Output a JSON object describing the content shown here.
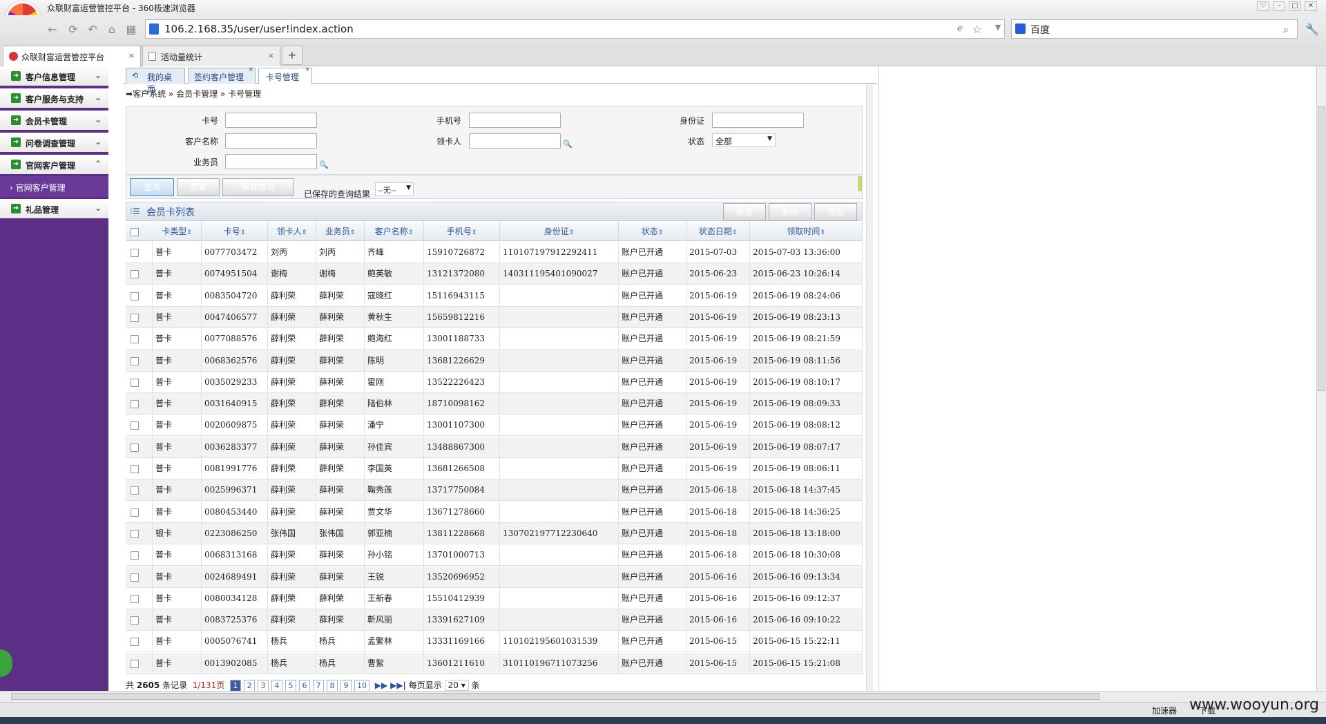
{
  "window": {
    "title": "众联财富运营管控平台 - 360极速浏览器"
  },
  "address_bar": {
    "url": "106.2.168.35/user/user!index.action",
    "search_engine": "百度"
  },
  "browser_tabs": [
    {
      "label": "众联财富运营管控平台"
    },
    {
      "label": "活动量统计"
    }
  ],
  "sidebar": {
    "items": [
      {
        "label": "客户信息管理"
      },
      {
        "label": "客户服务与支持"
      },
      {
        "label": "会员卡管理"
      },
      {
        "label": "问卷调查管理"
      },
      {
        "label": "官网客户管理"
      },
      {
        "label": "礼品管理"
      }
    ],
    "sub_item": "官网客户管理"
  },
  "inner_tabs": [
    {
      "label": "我的桌面"
    },
    {
      "label": "签约客户管理"
    },
    {
      "label": "卡号管理"
    }
  ],
  "breadcrumb": {
    "l1": "客户系统",
    "l2": "会员卡管理",
    "l3": "卡号管理"
  },
  "search": {
    "card_no": "卡号",
    "phone": "手机号",
    "id_card": "身份证",
    "customer_name": "客户名称",
    "receiver": "领卡人",
    "status": "状态",
    "status_value": "全部",
    "salesman": "业务员"
  },
  "buttons": {
    "query": "查询",
    "reset": "重置",
    "save_query": "保存查询",
    "saved_label": "已保存的查询结果",
    "saved_value": "--无--"
  },
  "grid": {
    "title": "会员卡列表",
    "actions": [
      "新增",
      "删除",
      "导出"
    ],
    "columns": [
      "卡类型",
      "卡号",
      "领卡人",
      "业务员",
      "客户名称",
      "手机号",
      "身份证",
      "状态",
      "状态日期",
      "领取时间"
    ],
    "rows": [
      [
        "普卡",
        "0077703472",
        "刘丙",
        "刘丙",
        "齐峰",
        "15910726872",
        "110107197912292411",
        "账户已开通",
        "2015-07-03",
        "2015-07-03 13:36:00"
      ],
      [
        "普卡",
        "0074951504",
        "谢梅",
        "谢梅",
        "鲍英敏",
        "13121372080",
        "140311195401090027",
        "账户已开通",
        "2015-06-23",
        "2015-06-23 10:26:14"
      ],
      [
        "普卡",
        "0083504720",
        "薛利荣",
        "薛利荣",
        "寇晓红",
        "15116943115",
        "",
        "账户已开通",
        "2015-06-19",
        "2015-06-19 08:24:06"
      ],
      [
        "普卡",
        "0047406577",
        "薛利荣",
        "薛利荣",
        "黄秋生",
        "15659812216",
        "",
        "账户已开通",
        "2015-06-19",
        "2015-06-19 08:23:13"
      ],
      [
        "普卡",
        "0077088576",
        "薛利荣",
        "薛利荣",
        "鲍海红",
        "13001188733",
        "",
        "账户已开通",
        "2015-06-19",
        "2015-06-19 08:21:59"
      ],
      [
        "普卡",
        "0068362576",
        "薛利荣",
        "薛利荣",
        "陈明",
        "13681226629",
        "",
        "账户已开通",
        "2015-06-19",
        "2015-06-19 08:11:56"
      ],
      [
        "普卡",
        "0035029233",
        "薛利荣",
        "薛利荣",
        "霍刚",
        "13522226423",
        "",
        "账户已开通",
        "2015-06-19",
        "2015-06-19 08:10:17"
      ],
      [
        "普卡",
        "0031640915",
        "薛利荣",
        "薛利荣",
        "陆伯林",
        "18710098162",
        "",
        "账户已开通",
        "2015-06-19",
        "2015-06-19 08:09:33"
      ],
      [
        "普卡",
        "0020609875",
        "薛利荣",
        "薛利荣",
        "潘宁",
        "13001107300",
        "",
        "账户已开通",
        "2015-06-19",
        "2015-06-19 08:08:12"
      ],
      [
        "普卡",
        "0036283377",
        "薛利荣",
        "薛利荣",
        "孙佳宾",
        "13488867300",
        "",
        "账户已开通",
        "2015-06-19",
        "2015-06-19 08:07:17"
      ],
      [
        "普卡",
        "0081991776",
        "薛利荣",
        "薛利荣",
        "李国英",
        "13681266508",
        "",
        "账户已开通",
        "2015-06-19",
        "2015-06-19 08:06:11"
      ],
      [
        "普卡",
        "0025996371",
        "薛利荣",
        "薛利荣",
        "鞠秀莲",
        "13717750084",
        "",
        "账户已开通",
        "2015-06-18",
        "2015-06-18 14:37:45"
      ],
      [
        "普卡",
        "0080453440",
        "薛利荣",
        "薛利荣",
        "贾文华",
        "13671278660",
        "",
        "账户已开通",
        "2015-06-18",
        "2015-06-18 14:36:25"
      ],
      [
        "银卡",
        "0223086250",
        "张伟国",
        "张伟国",
        "郭亚楠",
        "13811228668",
        "130702197712230640",
        "账户已开通",
        "2015-06-18",
        "2015-06-18 13:18:00"
      ],
      [
        "普卡",
        "0068313168",
        "薛利荣",
        "薛利荣",
        "孙小铭",
        "13701000713",
        "",
        "账户已开通",
        "2015-06-18",
        "2015-06-18 10:30:08"
      ],
      [
        "普卡",
        "0024689491",
        "薛利荣",
        "薛利荣",
        "王锐",
        "13520696952",
        "",
        "账户已开通",
        "2015-06-16",
        "2015-06-16 09:13:34"
      ],
      [
        "普卡",
        "0080034128",
        "薛利荣",
        "薛利荣",
        "王新春",
        "15510412939",
        "",
        "账户已开通",
        "2015-06-16",
        "2015-06-16 09:12:37"
      ],
      [
        "普卡",
        "0083725376",
        "薛利荣",
        "薛利荣",
        "靳风丽",
        "13391627109",
        "",
        "账户已开通",
        "2015-06-16",
        "2015-06-16 09:10:22"
      ],
      [
        "普卡",
        "0005076741",
        "杨兵",
        "杨兵",
        "孟繁林",
        "13331169166",
        "110102195601031539",
        "账户已开通",
        "2015-06-15",
        "2015-06-15 15:22:11"
      ],
      [
        "普卡",
        "0013902085",
        "杨兵",
        "杨兵",
        "曹絮",
        "13601211610",
        "310110196711073256",
        "账户已开通",
        "2015-06-15",
        "2015-06-15 15:21:08"
      ]
    ]
  },
  "pager": {
    "total_prefix": "共",
    "total": "2605",
    "total_suffix": "条记录",
    "page_info": "1/131页",
    "pages": [
      "1",
      "2",
      "3",
      "4",
      "5",
      "6",
      "7",
      "8",
      "9",
      "10"
    ],
    "per_page_label": "每页显示",
    "per_page": "20",
    "per_page_suffix": "条"
  },
  "status_bar": {
    "accelerator": "加速器",
    "download": "下载"
  },
  "watermark": "www.wooyun.org"
}
